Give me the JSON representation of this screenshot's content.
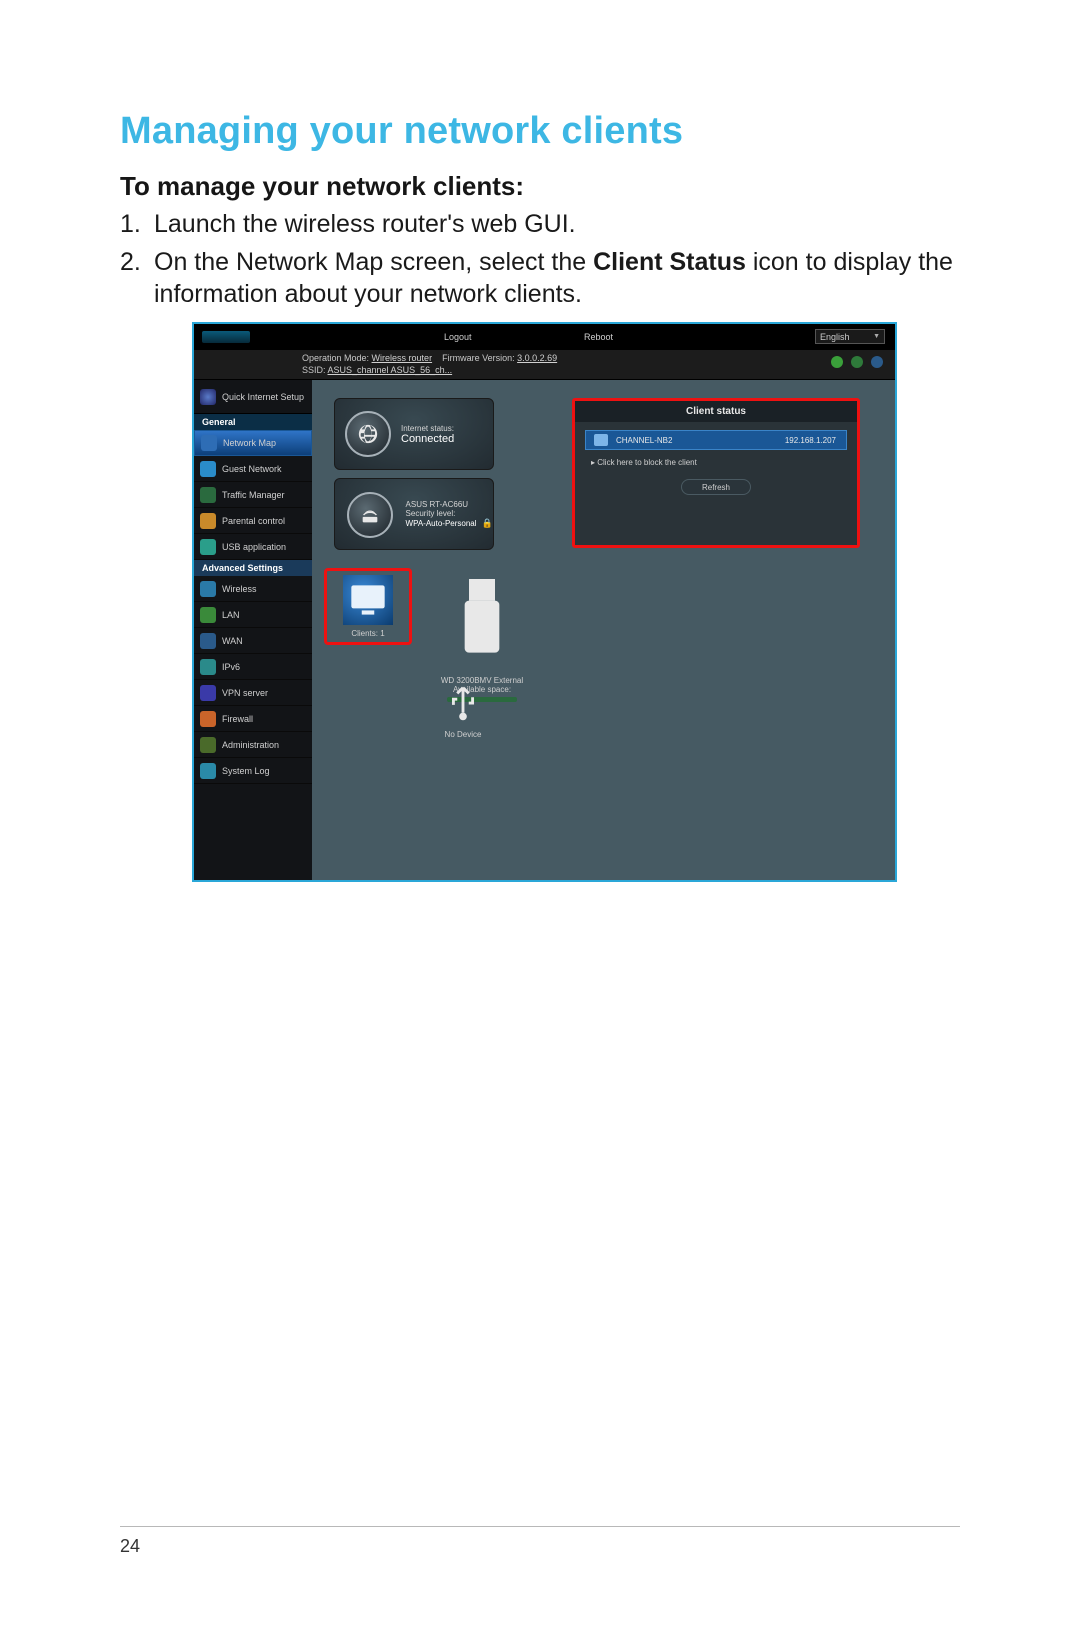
{
  "doc": {
    "section_title": "Managing your network clients",
    "subheading": "To manage your network clients:",
    "step1": "Launch the wireless router's web GUI.",
    "step2_pre": "On the Network Map screen, select the ",
    "step2_bold": "Client Status",
    "step2_post": " icon to display the information about your network clients.",
    "page_number": "24"
  },
  "router": {
    "topbar": {
      "logout": "Logout",
      "reboot": "Reboot",
      "language": "English"
    },
    "info": {
      "opmode_label": "Operation Mode: ",
      "opmode_value": "Wireless router",
      "fw_label": "Firmware Version: ",
      "fw_value": "3.0.0.2.69",
      "ssid_label": "SSID: ",
      "ssid_value": "ASUS_channel  ASUS_56_ch..."
    },
    "sidebar": {
      "qis": "Quick Internet Setup",
      "general_header": "General",
      "general": [
        "Network Map",
        "Guest Network",
        "Traffic Manager",
        "Parental control",
        "USB application"
      ],
      "adv_header": "Advanced Settings",
      "advanced": [
        "Wireless",
        "LAN",
        "WAN",
        "IPv6",
        "VPN server",
        "Firewall",
        "Administration",
        "System Log"
      ]
    },
    "cards": {
      "internet_label": "Internet status:",
      "internet_status": "Connected",
      "sec_model": "ASUS RT-AC66U",
      "sec_label": "Security level:",
      "sec_value": "WPA-Auto-Personal",
      "clients_label": "Clients:",
      "clients_count": "1",
      "usb_name": "WD 3200BMV External",
      "usb_space": "Available space:",
      "usb_none": "No Device"
    },
    "panel": {
      "title": "Client status",
      "client_name": "CHANNEL-NB2",
      "client_ip": "192.168.1.207",
      "block_link": "Click here to block the client",
      "refresh": "Refresh"
    }
  }
}
